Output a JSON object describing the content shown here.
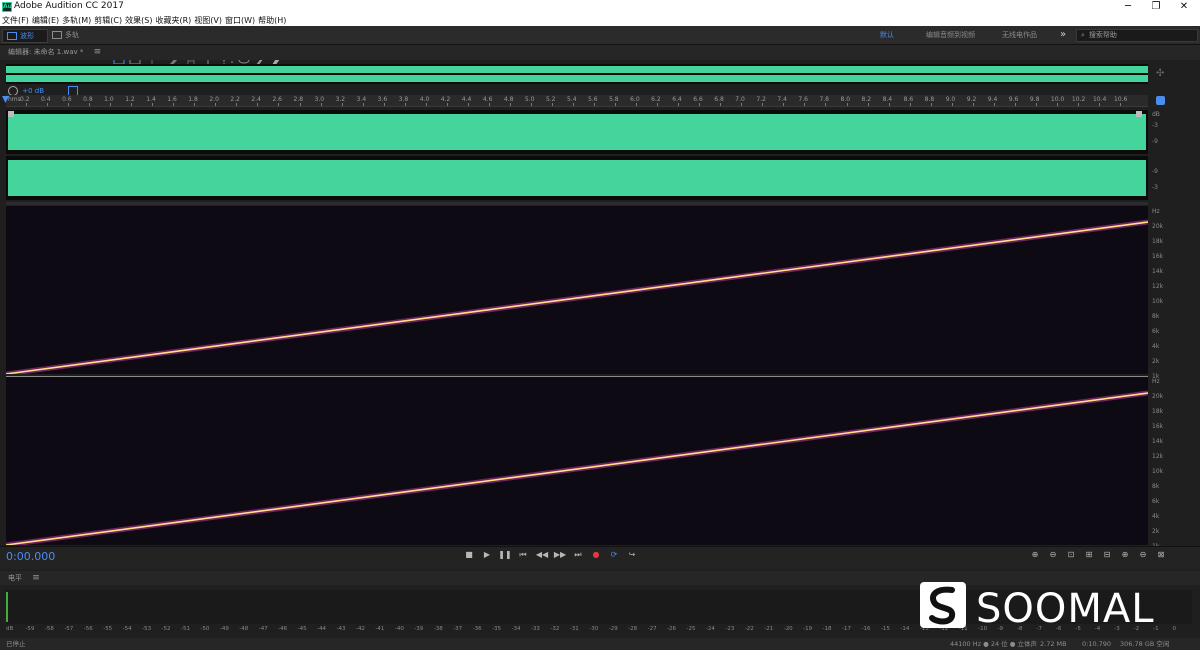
{
  "window": {
    "title": "Adobe Audition CC 2017",
    "logo": "Au",
    "min": "─",
    "max": "❐",
    "close": "✕"
  },
  "menu": [
    "文件(F)",
    "编辑(E)",
    "多轨(M)",
    "剪辑(C)",
    "效果(S)",
    "收藏夹(R)",
    "视图(V)",
    "窗口(W)",
    "帮助(H)"
  ],
  "toolbar": {
    "waveform_label": "波形",
    "multitrack_label": "多轨",
    "workspace_default": "默认",
    "workspace_edit_video": "编辑音频到视频",
    "workspace_radio": "无线电作品",
    "more": "»",
    "search_placeholder": "搜索帮助"
  },
  "editor": {
    "title": "编辑器: 未命名 1.wav *",
    "menu_icon": "≡",
    "gain": "+0 dB"
  },
  "ruler": {
    "start": "hms",
    "ticks": [
      "0.2",
      "0.4",
      "0.6",
      "0.8",
      "1.0",
      "1.2",
      "1.4",
      "1.6",
      "1.8",
      "2.0",
      "2.2",
      "2.4",
      "2.6",
      "2.8",
      "3.0",
      "3.2",
      "3.4",
      "3.6",
      "3.8",
      "4.0",
      "4.2",
      "4.4",
      "4.6",
      "4.8",
      "5.0",
      "5.2",
      "5.4",
      "5.6",
      "5.8",
      "6.0",
      "6.2",
      "6.4",
      "6.6",
      "6.8",
      "7.0",
      "7.2",
      "7.4",
      "7.6",
      "7.8",
      "8.0",
      "8.2",
      "8.4",
      "8.6",
      "8.8",
      "9.0",
      "9.2",
      "9.4",
      "9.6",
      "9.8",
      "10.0",
      "10.2",
      "10.4",
      "10.6"
    ]
  },
  "db_scale": [
    "dB",
    "-3",
    "-9",
    "-9",
    "-3"
  ],
  "freq_scale": [
    "Hz",
    "20k",
    "18k",
    "16k",
    "14k",
    "12k",
    "10k",
    "8k",
    "6k",
    "4k",
    "2k",
    "1k"
  ],
  "transport": {
    "timecode": "0:00.000",
    "buttons": [
      "■",
      "▶",
      "❚❚",
      "⏮",
      "◀◀",
      "▶▶",
      "⏭",
      "●",
      "⟳",
      "↪"
    ],
    "zoom": [
      "⊕",
      "⊖",
      "⊡",
      "⊞",
      "⊟",
      "⊕",
      "⊖",
      "⊠"
    ]
  },
  "level": {
    "title": "电平",
    "menu_icon": "≡",
    "scale": [
      "dB",
      "-59",
      "-58",
      "-57",
      "-56",
      "-55",
      "-54",
      "-53",
      "-52",
      "-51",
      "-50",
      "-49",
      "-48",
      "-47",
      "-46",
      "-45",
      "-44",
      "-43",
      "-42",
      "-41",
      "-40",
      "-39",
      "-38",
      "-37",
      "-36",
      "-35",
      "-34",
      "-33",
      "-32",
      "-31",
      "-30",
      "-29",
      "-28",
      "-27",
      "-26",
      "-25",
      "-24",
      "-23",
      "-22",
      "-21",
      "-20",
      "-19",
      "-18",
      "-17",
      "-16",
      "-15",
      "-14",
      "-13",
      "-12",
      "-11",
      "-10",
      "-9",
      "-8",
      "-7",
      "-6",
      "-5",
      "-4",
      "-3",
      "-2",
      "-1",
      "0"
    ]
  },
  "status": {
    "left": "已停止",
    "sample_info": "44100 Hz ● 24 位 ● 立体声",
    "size": "2.72 MB",
    "duration": "0:10.790",
    "free": "306.78 GB 空闲"
  },
  "watermark": {
    "text": "SOOMAL"
  },
  "colors": {
    "waveform": "#43d59b",
    "spectral_bg": "#0e0a14",
    "sweep": "#ffe38a",
    "timecode": "#4a8cf0",
    "record": "#e0393e"
  }
}
